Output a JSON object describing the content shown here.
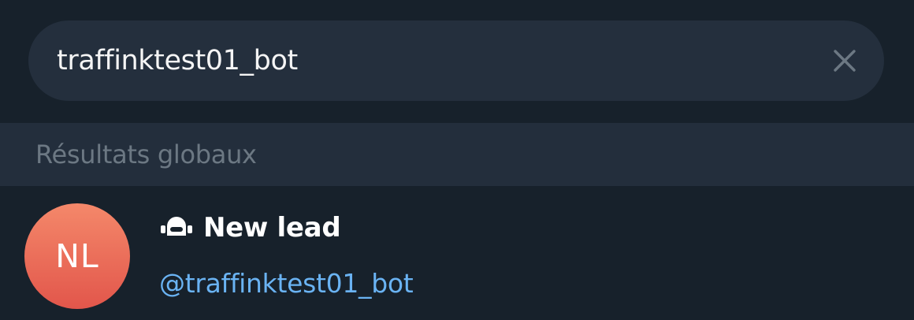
{
  "search": {
    "value": "traffinktest01_bot",
    "clear_icon": "close-icon"
  },
  "section": {
    "title": "Résultats globaux"
  },
  "results": [
    {
      "avatar_initials": "NL",
      "name": "New lead",
      "username": "@traffinktest01_bot",
      "type_icon": "bot-icon"
    }
  ],
  "colors": {
    "background": "#17212b",
    "search_field": "#242f3d",
    "section_header": "#232e3c",
    "link": "#6ab3f3",
    "avatar_top": "#f4886a",
    "avatar_bottom": "#e2564b"
  }
}
